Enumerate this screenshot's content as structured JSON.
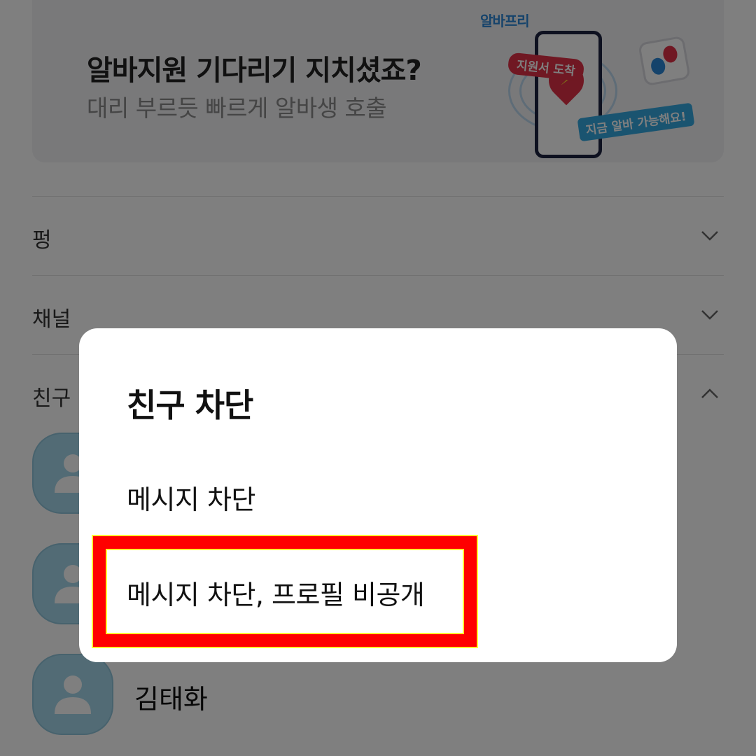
{
  "banner": {
    "brand": "알바프리",
    "title": "알바지원 기다리기 지치셨죠?",
    "subtitle": "대리 부르듯 빠르게 알바생 호출",
    "tag_applied": "지원서 도착",
    "tag_available": "지금 알바 가능해요!"
  },
  "sections": [
    {
      "label": "펑",
      "state": "collapsed",
      "icon": "chevron-down-icon"
    },
    {
      "label": "채널",
      "state": "collapsed",
      "icon": "chevron-down-icon"
    },
    {
      "label": "친구",
      "state": "expanded",
      "icon": "chevron-up-icon"
    }
  ],
  "friends": [
    {
      "name": ""
    },
    {
      "name": ""
    },
    {
      "name": "김태화"
    }
  ],
  "dialog": {
    "title": "친구 차단",
    "options": [
      {
        "label": "메시지 차단"
      },
      {
        "label": "메시지 차단, 프로필 비공개"
      }
    ]
  },
  "highlight_color": "#ff0000",
  "avatar_color": "#a5d6ea"
}
